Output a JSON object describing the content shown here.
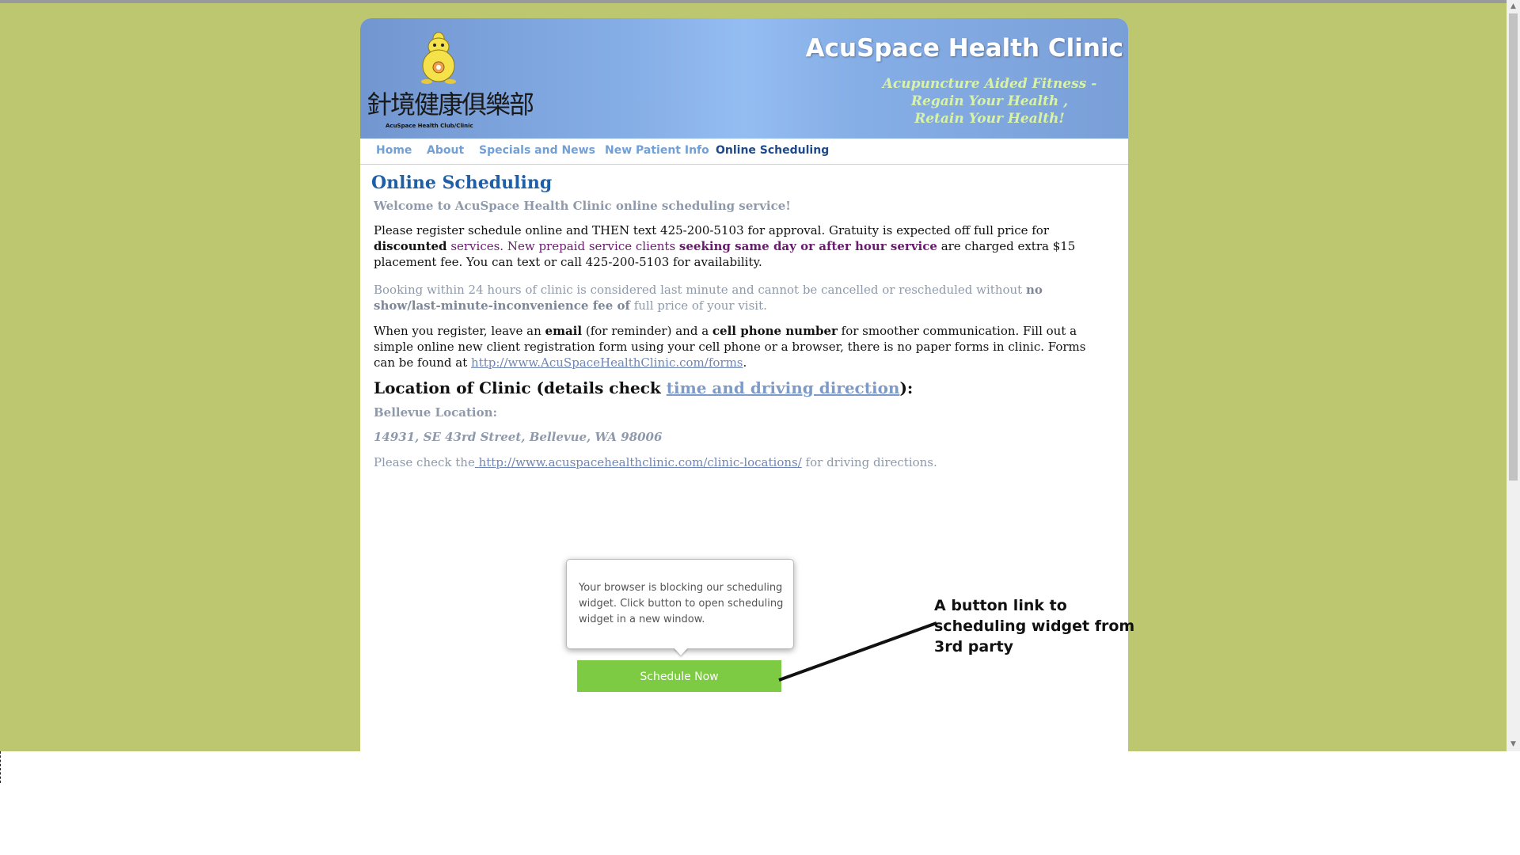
{
  "header": {
    "title": "AcuSpace Health Clinic",
    "tagline": [
      "Acupuncture Aided Fitness -",
      "Regain Your Health ,",
      "Retain Your Health!"
    ],
    "logo_chinese": "針境健康俱樂部",
    "logo_sub": "AcuSpace Health Club/Clinic"
  },
  "nav": {
    "items": [
      "Home",
      "About",
      "Specials and News",
      "New Patient Info",
      "Online Scheduling"
    ],
    "active": "Online Scheduling"
  },
  "content": {
    "title": "Online Scheduling",
    "welcome": "Welcome to AcuSpace Health Clinic online scheduling service!",
    "p1": {
      "a": "Please register schedule online and THEN text 425-200-5103 for approval. Gratuity is expected off full price for ",
      "b": "discounted",
      "c": " services. New prepaid service clients ",
      "d": "seeking same day or after hour service",
      "e": "  are charged extra $15 placement fee. You can text or call 425-200-5103 for availability."
    },
    "p2": {
      "a": "Booking within 24 hours of clinic is considered last minute and cannot be cancelled or rescheduled without ",
      "b": "no show/last-minute-inconvenience fee of",
      "c": " full price of your visit."
    },
    "p3": {
      "a": "When you register, leave an ",
      "b": "email",
      "c": " (for reminder) and a ",
      "d": "cell phone number",
      "e": " for smoother communication. Fill out a simple online new client registration form using your cell phone or a browser, there is no paper forms in clinic. Forms can be found at ",
      "link": "http://www.AcuSpaceHealthClinic.com/forms",
      "end": "."
    },
    "location_heading": {
      "a": "Location of Clinic (details check ",
      "link": "time and driving direction",
      "b": "):"
    },
    "bellevue_label": "Bellevue Location:",
    "address": "14931, SE 43rd Street, Bellevue, WA 98006",
    "directions": {
      "a": "Please check the",
      "link": " http://www.acuspacehealthclinic.com/clinic-locations/",
      "b": " for driving directions."
    }
  },
  "widget": {
    "message": "Your browser is blocking our scheduling widget. Click button to open scheduling widget in a new window.",
    "button_label": "Schedule Now",
    "button_color": "#7dcb43"
  },
  "annotation": {
    "text": "A button link to scheduling widget from 3rd party"
  },
  "colors": {
    "background": "#bdc76f",
    "nav_link": "#71a0d6",
    "nav_active": "#1e4a8a",
    "title": "#1f5fa8"
  }
}
